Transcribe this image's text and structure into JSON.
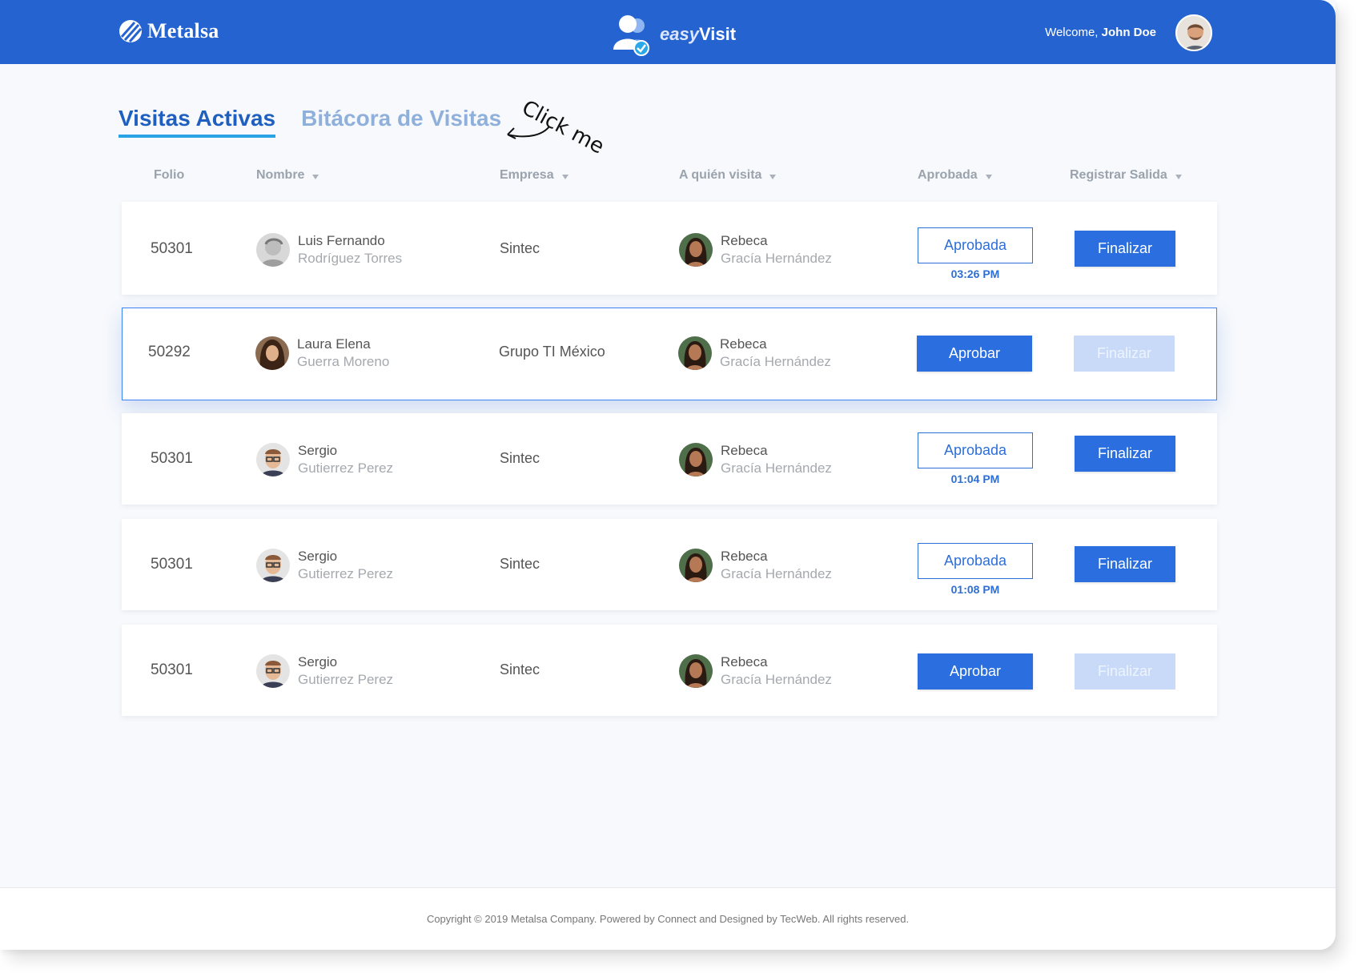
{
  "header": {
    "brand": "Metalsa",
    "product_light": "easy",
    "product_bold": "Visit",
    "welcome_prefix": "Welcome,",
    "user_name": "John Doe"
  },
  "tabs": [
    {
      "label": "Visitas Activas",
      "active": true
    },
    {
      "label": "Bitácora de Visitas",
      "active": false
    }
  ],
  "annotation": "Click me",
  "columns": {
    "folio": "Folio",
    "nombre": "Nombre",
    "empresa": "Empresa",
    "visita": "A quién visita",
    "aprobada": "Aprobada",
    "salida": "Registrar Salida"
  },
  "rows": [
    {
      "folio": "50301",
      "first": "Luis Fernando",
      "last": "Rodríguez Torres",
      "empresa": "Sintec",
      "host_first": "Rebeca",
      "host_last": "Gracía Hernández",
      "status": "Aprobada",
      "time": "03:26 PM",
      "finalize": "Finalizar"
    },
    {
      "folio": "50292",
      "first": "Laura Elena",
      "last": "Guerra Moreno",
      "empresa": "Grupo TI México",
      "host_first": "Rebeca",
      "host_last": "Gracía Hernández",
      "status": "Aprobar",
      "time": "",
      "finalize": "Finalizar"
    },
    {
      "folio": "50301",
      "first": "Sergio",
      "last": "Gutierrez Perez",
      "empresa": "Sintec",
      "host_first": "Rebeca",
      "host_last": "Gracía Hernández",
      "status": "Aprobada",
      "time": "01:04 PM",
      "finalize": "Finalizar"
    },
    {
      "folio": "50301",
      "first": "Sergio",
      "last": "Gutierrez Perez",
      "empresa": "Sintec",
      "host_first": "Rebeca",
      "host_last": "Gracía Hernández",
      "status": "Aprobada",
      "time": "01:08 PM",
      "finalize": "Finalizar"
    },
    {
      "folio": "50301",
      "first": "Sergio",
      "last": "Gutierrez Perez",
      "empresa": "Sintec",
      "host_first": "Rebeca",
      "host_last": "Gracía Hernández",
      "status": "Aprobar",
      "time": "",
      "finalize": "Finalizar"
    }
  ],
  "footer": "Copyright © 2019 Metalsa Company. Powered by Connect and Designed by TecWeb. All rights reserved.",
  "colors": {
    "header": "#2563d1",
    "accent": "#2a6ee0",
    "tab_underline": "#29a3e6",
    "disabled": "#c8daf7"
  }
}
